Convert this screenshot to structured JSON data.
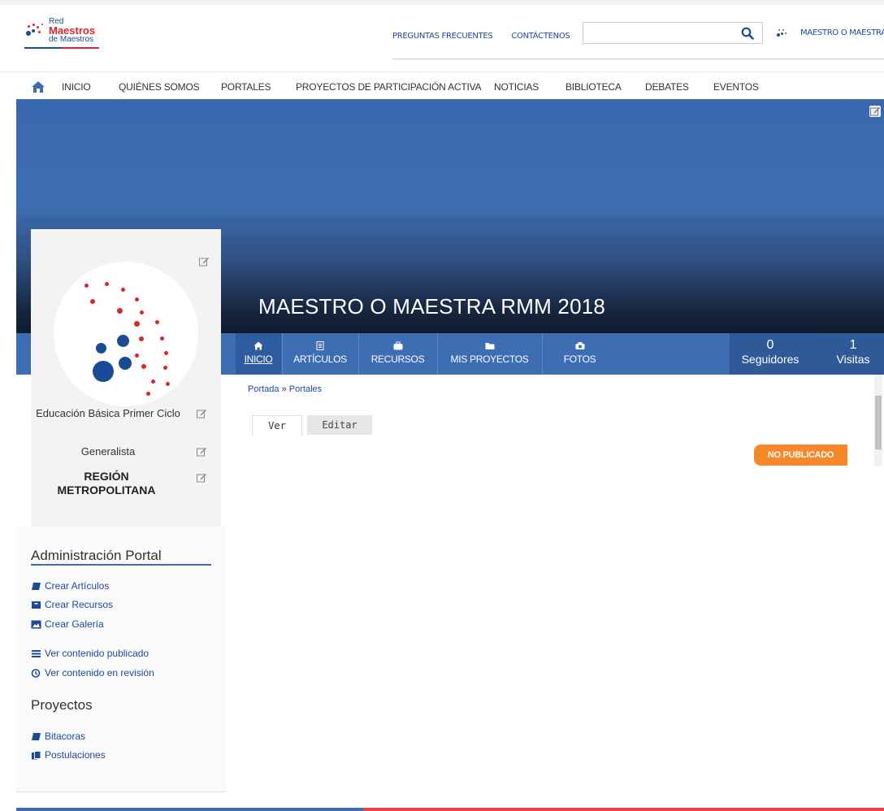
{
  "header": {
    "logo": {
      "line1": "Red",
      "line2": "Maestros",
      "line3": "de Maestros"
    },
    "links": [
      "PREGUNTAS FRECUENTES",
      "CONTÁCTENOS"
    ],
    "search": {
      "placeholder": "",
      "value": ""
    },
    "user_name": "MAESTRO O MAESTRA ..."
  },
  "nav": {
    "items": [
      "INICIO",
      "QUIÉNES SOMOS",
      "PORTALES",
      "PROYECTOS DE PARTICIPACIÓN ACTIVA",
      "NOTICIAS",
      "BIBLIOTECA",
      "DEBATES",
      "EVENTOS"
    ]
  },
  "banner": {
    "title": "MAESTRO O MAESTRA RMM 2018"
  },
  "tabs": [
    {
      "label": "INICIO",
      "icon": "home-icon"
    },
    {
      "label": "ARTÍCULOS",
      "icon": "document-icon"
    },
    {
      "label": "RECURSOS",
      "icon": "briefcase-icon"
    },
    {
      "label": "MIS PROYECTOS",
      "icon": "folder-icon"
    },
    {
      "label": "FOTOS",
      "icon": "camera-icon"
    }
  ],
  "stats": {
    "followers_count": "0",
    "followers_label": "Seguidores",
    "visits_count": "1",
    "visits_label": "Visitas"
  },
  "profile": {
    "level": "Educación Básica Primer Ciclo",
    "specialty": "Generalista",
    "region": "REGIÓN METROPOLITANA"
  },
  "sidebar": {
    "admin_title": "Administración Portal",
    "admin_links": [
      "Crear Artículos",
      "Crear Recursos",
      "Crear Galería"
    ],
    "content_links": [
      "Ver contenido publicado",
      "Ver contenido en revisión"
    ],
    "projects_title": "Proyectos",
    "project_links": [
      "Bitacoras",
      "Postulaciones"
    ]
  },
  "content": {
    "breadcrumb": {
      "home": "Portada",
      "separator": "»",
      "current": "Portales"
    },
    "view_tabs": [
      "Ver",
      "Editar"
    ],
    "status": "NO PUBLICADO"
  },
  "colors": {
    "primary": "#3d6db2",
    "accent_red": "#d9262f",
    "status_orange": "#f7872a"
  }
}
